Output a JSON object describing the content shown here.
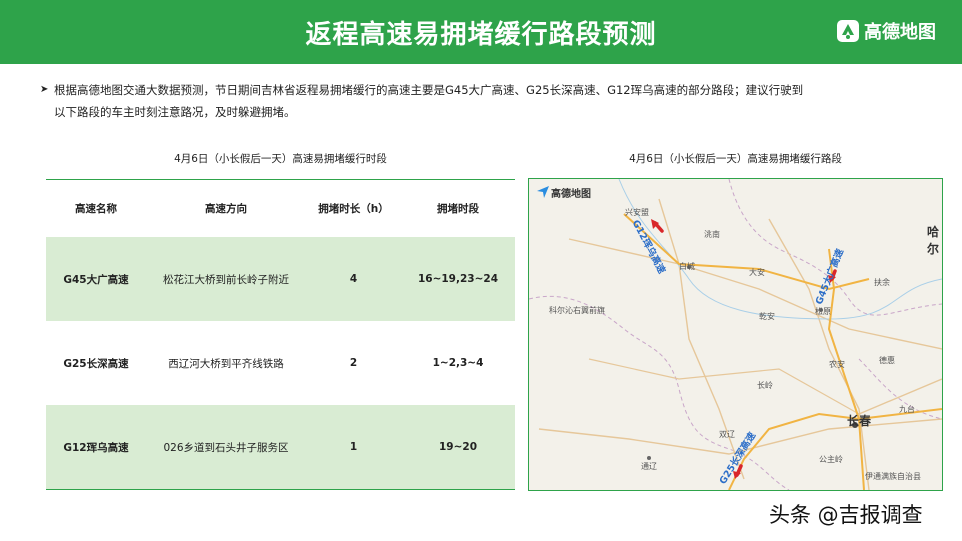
{
  "header": {
    "title": "返程高速易拥堵缓行路段预测",
    "brand_name": "高德地图",
    "background_color": "#2ea34a"
  },
  "intro": {
    "line1": "根据高德地图交通大数据预测，节日期间吉林省返程易拥堵缓行的高速主要是G45大广高速、G25长深高速、G12珲乌高速的部分路段；建议行驶到",
    "line2": "以下路段的车主时刻注意路况，及时躲避拥堵。"
  },
  "table_caption": "4月6日（小长假后一天）高速易拥堵缓行时段",
  "map_caption": "4月6日（小长假后一天）高速易拥堵缓行路段",
  "table": {
    "headers": [
      "高速名称",
      "高速方向",
      "拥堵时长（h）",
      "拥堵时段"
    ],
    "rows": [
      {
        "name": "G45大广高速",
        "direction": "松花江大桥到前长岭子附近",
        "duration": "4",
        "period": "16~19,23~24"
      },
      {
        "name": "G25长深高速",
        "direction": "西辽河大桥到平齐线铁路",
        "duration": "2",
        "period": "1~2,3~4"
      },
      {
        "name": "G12珲乌高速",
        "direction": "026乡道到石头井子服务区",
        "duration": "1",
        "period": "19~20"
      }
    ]
  },
  "map": {
    "brand": "高德地图",
    "highway_labels": [
      "G12珲乌高速",
      "G45大广高速",
      "G25长深高速"
    ],
    "cities": {
      "baicheng": "白城",
      "songyuan": "松原",
      "changchun": "长春",
      "tongliao": "通辽",
      "xinganmeng": "兴安盟",
      "taonan": "洮南",
      "da_an": "大安",
      "qian_an": "乾安",
      "nongan": "农安",
      "dehui": "德惠",
      "changling": "长岭",
      "shuangliao": "双辽",
      "gongzhuling": "公主岭",
      "harbin_partial": "哈尔",
      "yitong": "伊通满族自治县",
      "fuyu": "扶余",
      "keerqin": "科尔沁右翼前旗",
      "jiutai": "九台"
    },
    "route_color": "#2c6ec8",
    "congestion_color": "#d9262a"
  },
  "watermark": "头条 @吉报调查"
}
